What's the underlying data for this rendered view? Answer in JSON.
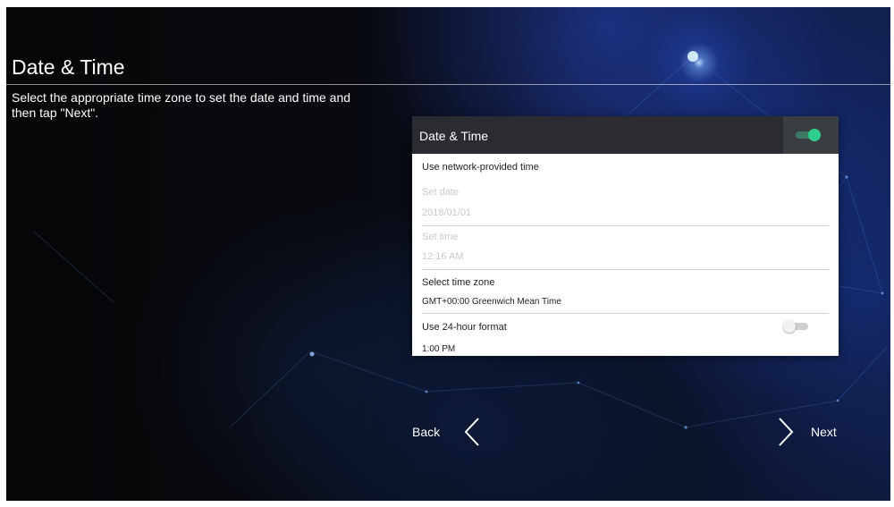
{
  "page": {
    "title": "Date & Time",
    "instruction": "Select the appropriate time zone to set the date and time and then tap \"Next\"."
  },
  "panel": {
    "title": "Date & Time",
    "network_time_toggle": "on",
    "network_time_label": "Use network-provided time",
    "set_date_label": "Set date",
    "set_date_value": "2018/01/01",
    "set_time_label": "Set time",
    "set_time_value": "12:16 AM",
    "timezone_label": "Select time zone",
    "timezone_value": "GMT+00:00 Greenwich Mean Time",
    "format_label": "Use 24-hour format",
    "format_toggle": "off",
    "format_example": "1:00 PM"
  },
  "nav": {
    "back_label": "Back",
    "next_label": "Next"
  },
  "colors": {
    "accent": "#2ecf8c",
    "header_bg": "#2a2c31",
    "background": "#08090d"
  },
  "icons": {
    "back": "chevron-left-icon",
    "next": "chevron-right-icon"
  }
}
